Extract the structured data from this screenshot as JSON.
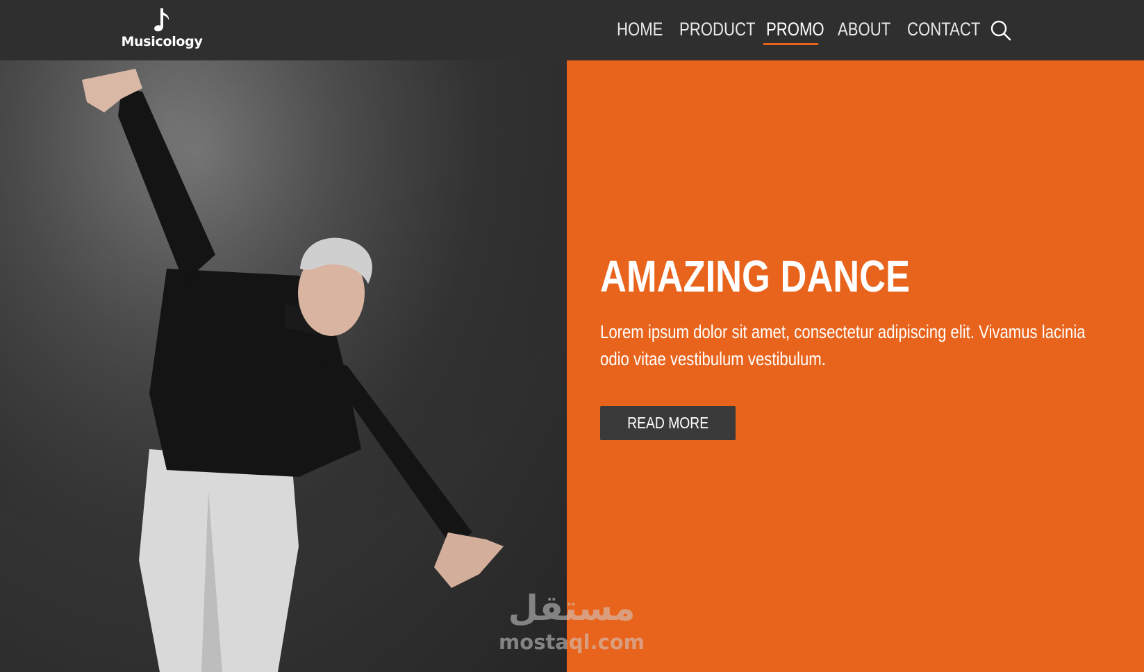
{
  "header": {
    "brand": "Musicology",
    "logo_icon": "music-note-icon",
    "nav": [
      {
        "label": "HOME"
      },
      {
        "label": "PRODUCT"
      },
      {
        "label": "PROMO",
        "active": true
      },
      {
        "label": "ABOUT"
      },
      {
        "label": "CONTACT"
      }
    ],
    "search_icon": "search-icon",
    "accent_color": "#e8641c"
  },
  "hero": {
    "title": "AMAZING DANCE",
    "description": "Lorem ipsum dolor sit amet, consectetur adipiscing elit. Vivamus lacinia odio vitae vestibulum vestibulum.",
    "button_label": "READ MORE",
    "panel_color": "#e8641c",
    "button_color": "#3a3a3a"
  },
  "watermark": {
    "arabic": "مستقل",
    "latin": "mostaql.com"
  }
}
